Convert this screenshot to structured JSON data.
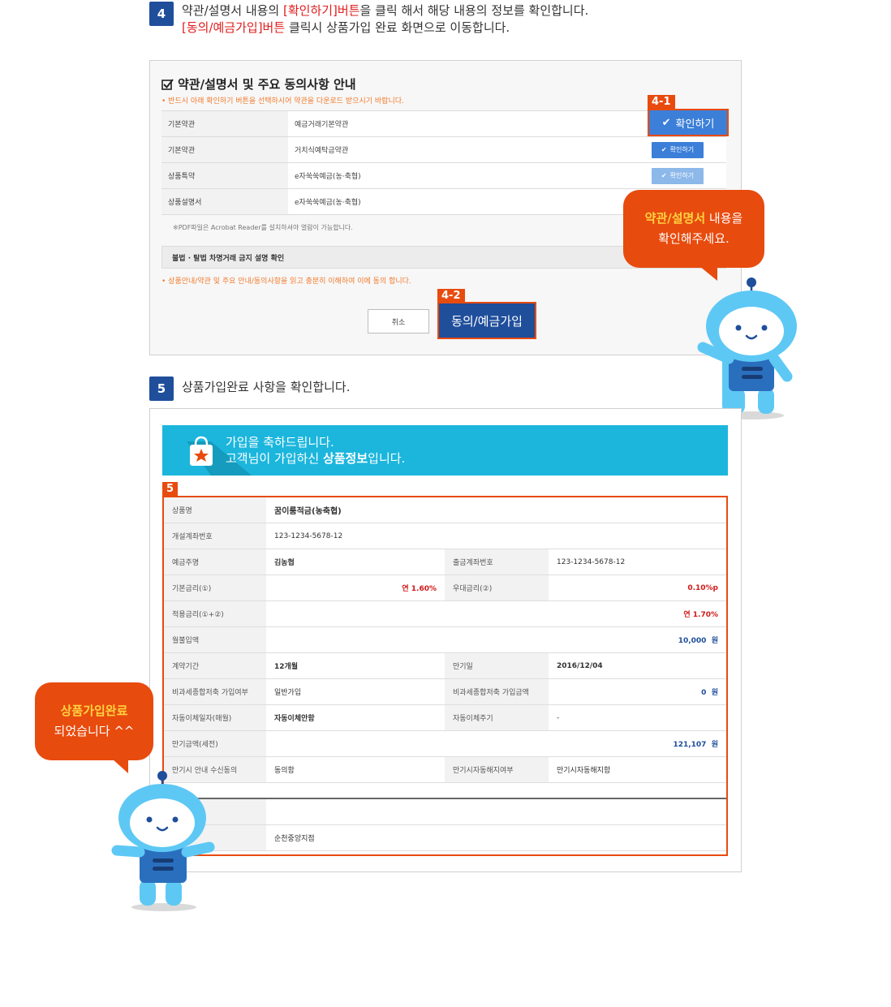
{
  "step4": {
    "number": "4",
    "line1_a": "약관/설명서 내용의 ",
    "line1_red": "[확인하기]버튼",
    "line1_b": "을 클릭 해서 해당 내용의 정보를 확인합니다.",
    "line2_red": "[동의/예금가입]버튼",
    "line2_b": " 클릭시 상품가입 완료 화면으로 이동합니다."
  },
  "terms": {
    "title": "약관/설명서 및 주요 동의사항 안내",
    "note": "• 반드시 아래 확인하기 버튼을 선택하시어 약관을 다운로드 받으시기 바랍니다.",
    "rows": [
      {
        "label": "기본약관",
        "value": "예금거래기본약관",
        "button": "확인하기"
      },
      {
        "label": "기본약관",
        "value": "거치식예탁금약관",
        "button": "확인하기"
      },
      {
        "label": "상품특약",
        "value": "e자쑥쑥예금(농·축협)",
        "button": "확인하기"
      },
      {
        "label": "상품설명서",
        "value": "e자쑥쑥예금(농·축협)",
        "button": ""
      }
    ],
    "pdf_note": "※PDF파일은 Acrobat Reader를 설치하셔야 열람이 가능합니다.",
    "illegal_title": "불법 · 탈법 차명거래 금지 설명 확인",
    "agree_note": "• 상품안내/약관 및 주요 안내/동의사항을 읽고 충분히 이해하여 이에 동의 합니다.",
    "cancel_label": "취소",
    "join_label": "동의/예금가입",
    "tag_41": "4-1",
    "tag_42": "4-2"
  },
  "bubble1": {
    "highlight": "약관/설명서",
    "text1": " 내용을",
    "text2": "확인해주세요."
  },
  "step5": {
    "number": "5",
    "text": "상품가입완료 사항을 확인합니다."
  },
  "banner": {
    "line1": "가입을 축하드립니다.",
    "line2_a": "고객님이 가입하신 ",
    "line2_b": "상품정보",
    "line2_c": "입니다."
  },
  "result": {
    "tag": "5",
    "product_label": "상품명",
    "product_value": "꿈이룸적금(농축협)",
    "account_label": "개설계좌번호",
    "account_value": "123-1234-5678-12",
    "owner_label": "예금주명",
    "owner_value": "김농협",
    "out_account_label": "출금계좌번호",
    "out_account_value": "123-1234-5678-12",
    "base_rate_label": "기본금리(①)",
    "base_rate_value": "연 1.60%",
    "pref_rate_label": "우대금리(②)",
    "pref_rate_value": "0.10%p",
    "applied_rate_label": "적용금리(①+②)",
    "applied_rate_value": "연 1.70%",
    "monthly_label": "월불입액",
    "monthly_value": "10,000",
    "monthly_unit": "원",
    "period_label": "계약기간",
    "period_value": "12개월",
    "maturity_label": "만기일",
    "maturity_value": "2016/12/04",
    "taxfree_label": "비과세종합저축 가입여부",
    "taxfree_value": "일반가입",
    "taxfree_amt_label": "비과세종합저축 가입금액",
    "taxfree_amt_value": "0",
    "taxfree_amt_unit": "원",
    "autodate_label": "자동이체일자(매월)",
    "autodate_value": "자동이체안함",
    "autocycle_label": "자동이체주기",
    "autocycle_value": "-",
    "expected_label": "만기금액(세전)",
    "expected_value": "121,107",
    "expected_unit": "원",
    "notice_label": "만기시 안내 수신동의",
    "notice_value": "동의함",
    "autoclose_label": "만기시자동해지여부",
    "autoclose_value": "만기시자동해지함",
    "branch_value": "순천중앙지점"
  },
  "bubble2": {
    "highlight": "상품가입완료",
    "text": "되었습니다 ^^"
  },
  "colors": {
    "accent_blue": "#1f4e9b",
    "accent_orange": "#e84b0e",
    "banner": "#1cb6dd",
    "robot": "#5ec8f5"
  }
}
